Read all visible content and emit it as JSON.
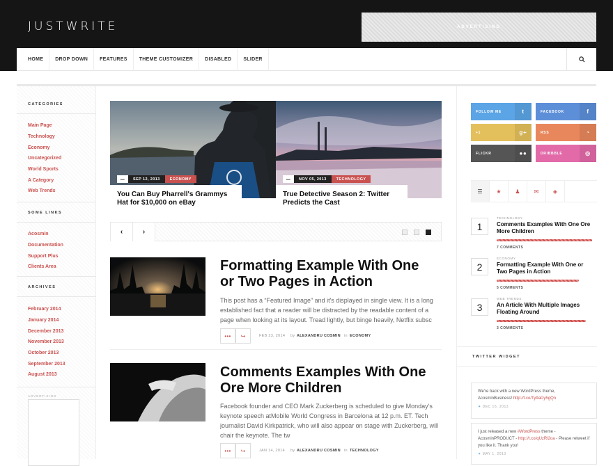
{
  "header": {
    "logo": "JUSTWRITE",
    "ad": "ADVERTISING"
  },
  "nav": {
    "items": [
      "HOME",
      "DROP DOWN",
      "FEATURES",
      "THEME CUSTOMIZER",
      "DISABLED",
      "SLIDER"
    ]
  },
  "sidebar": {
    "categories_title": "CATEGORIES",
    "categories": [
      "Main Page",
      "Technology",
      "Economy",
      "Uncategorized",
      "World Sports",
      "A Category",
      "Web Trends"
    ],
    "links_title": "SOME LINKS",
    "links": [
      "Acosmin",
      "Documentation",
      "Support Plus",
      "Clients Area"
    ],
    "archives_title": "ARCHIVES",
    "archives": [
      "February 2014",
      "January 2014",
      "December 2013",
      "November 2013",
      "October 2013",
      "September 2013",
      "August 2013"
    ],
    "ad_label": "ADVERTISING"
  },
  "slider": {
    "slides": [
      {
        "date": "SEP 12, 2013",
        "category": "ECONOMY",
        "title": "You Can Buy Pharrell's Grammys Hat for $10,000 on eBay"
      },
      {
        "date": "NOV 05, 2013",
        "category": "TECHNOLOGY",
        "title": "True Detective Season 2: Twitter Predicts the Cast"
      }
    ],
    "prev": "‹",
    "next": "›"
  },
  "posts": [
    {
      "title": "Formatting Example With One or Two Pages in Action",
      "excerpt": "This post has a “Featured Image” and it's displayed in single view. It is a long established fact that a reader will be distracted by the readable content of a page when looking at its layout. Tread lightly, but binge heavily, Netflix subsc",
      "date": "FEB 23, 2014",
      "by": "by",
      "author": "ALEXANDRU COSMIN",
      "in": "in",
      "category": "ECONOMY"
    },
    {
      "title": "Comments Examples With One Ore More Children",
      "excerpt": "Facebook founder and CEO Mark Zuckerberg is scheduled to give Monday's keynote speech atMobile World Congress in Barcelona at 12 p.m. ET. Tech journalist David Kirkpatrick, who will also appear on stage with Zuckerberg, will chair the keynote. The tw",
      "date": "JAN 14, 2014",
      "by": "by",
      "author": "ALEXANDRU COSMIN",
      "in": "in",
      "category": "TECHNOLOGY"
    }
  ],
  "social": [
    {
      "label": "FOLLOW ME",
      "color": "#5ba4e5"
    },
    {
      "label": "FACEBOOK",
      "color": "#5d8fd9"
    },
    {
      "label": "+1",
      "color": "#e3c05c"
    },
    {
      "label": "RSS",
      "color": "#e8875c"
    },
    {
      "label": "FLICKR",
      "color": "#555555"
    },
    {
      "label": "DRIBBBLE",
      "color": "#e36aa9"
    }
  ],
  "popular": [
    {
      "num": "1",
      "category": "TECHNOLOGY",
      "title": "Comments Examples With One Ore More Children",
      "comments": "7 COMMENTS"
    },
    {
      "num": "2",
      "category": "ECONOMY",
      "title": "Formatting Example With One or Two Pages in Action",
      "comments": "5 COMMENTS"
    },
    {
      "num": "3",
      "category": "WEB TRENDS",
      "title": "An Article With Multiple Images Floating Around",
      "comments": "3 COMMENTS"
    }
  ],
  "twitter": {
    "title": "TWITTER WIDGET",
    "tweets": [
      {
        "text": "We're back with a new WordPress theme, AcosminBusiness!",
        "link": "http://t.co/Ty9aDy5gQn",
        "date": "DEC 16, 2013"
      },
      {
        "pre": "I just released a new",
        "hashtag": "#WordPress",
        "mid": "theme - AcosminPRODUCT -",
        "link": "http://t.co/qUzRl2oa",
        "post": "- Please retweet if you like it. Thank you!",
        "date": "MAY 1, 2013"
      }
    ]
  },
  "colors": {
    "accent": "#c9514f",
    "header_bg": "#151515"
  }
}
